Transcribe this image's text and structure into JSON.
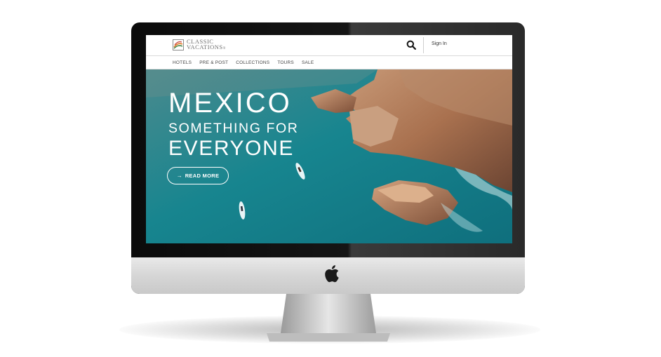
{
  "brand": {
    "line1": "CLASSIC",
    "line2": "VACATIONS",
    "trademark": "®"
  },
  "header": {
    "sign_in": "Sign In",
    "search_icon": "search-icon"
  },
  "nav": {
    "items": [
      "HOTELS",
      "PRE & POST",
      "COLLECTIONS",
      "TOURS",
      "SALE"
    ]
  },
  "hero": {
    "title": "MEXICO",
    "subtitle": "SOMETHING FOR",
    "subtitle2": "EVERYONE",
    "cta": "READ MORE",
    "cta_icon": "arrow-right-icon"
  },
  "device": {
    "logo_icon": "apple-logo-icon"
  },
  "colors": {
    "ocean": "#1f8a92",
    "rock": "#b07a5a",
    "bezel": "#111111",
    "chin": "#d8d8d8"
  }
}
